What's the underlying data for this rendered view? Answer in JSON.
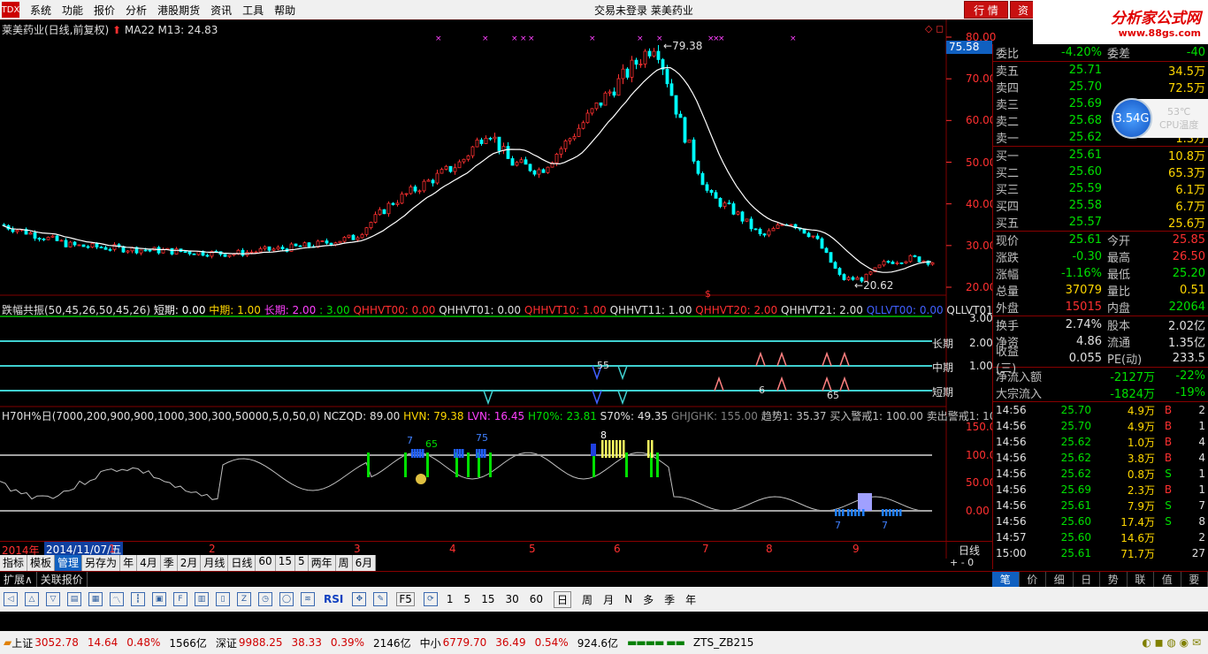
{
  "menu": {
    "logo": "TDX",
    "items": [
      "系统",
      "功能",
      "报价",
      "分析",
      "港股期货",
      "资讯",
      "工具",
      "帮助"
    ],
    "center": "交易未登录   莱美药业",
    "btn_quote": "行 情",
    "btn_info": "资"
  },
  "brand": {
    "title": "分析家公式网",
    "url": "www.88gs.com"
  },
  "main_chart": {
    "title": "莱美药业(日线,前复权)",
    "ma": "MA22  M13: 24.83",
    "price_labels": [
      "80.00",
      "70.00",
      "60.00",
      "50.00",
      "40.00",
      "30.00",
      "20.00"
    ],
    "current_price_tag": "75.58",
    "high_label": "79.38",
    "low_label": "20.62",
    "dollar_mark": "$"
  },
  "indicator1": {
    "header": "跌幅共振(50,45,26,50,45,26)",
    "items": [
      {
        "t": "短期: 0.00",
        "c": "#ffffff"
      },
      {
        "t": "中期: 1.00",
        "c": "#ffd700"
      },
      {
        "t": "长期: 2.00",
        "c": "#ff40ff"
      },
      {
        "t": ": 3.00",
        "c": "#00e000"
      },
      {
        "t": "QHHVT00: 0.00",
        "c": "#ff3030"
      },
      {
        "t": "QHHVT01: 0.00",
        "c": "#e0e0e0"
      },
      {
        "t": "QHHVT10: 1.00",
        "c": "#ff3030"
      },
      {
        "t": "QHHVT11: 1.00",
        "c": "#e0e0e0"
      },
      {
        "t": "QHHVT20: 2.00",
        "c": "#ff3030"
      },
      {
        "t": "QHHVT21: 2.00",
        "c": "#e0e0e0"
      },
      {
        "t": "QLLVT00: 0.00",
        "c": "#4060ff"
      },
      {
        "t": "QLLVT01: 0.0",
        "c": "#e0e0e0"
      }
    ],
    "axis": [
      "3.00",
      "2.00",
      "1.00"
    ],
    "lines": [
      "长期",
      "中期",
      "短期"
    ],
    "marks": [
      "55",
      "6",
      "65"
    ]
  },
  "indicator2": {
    "header": "H70H%日(7000,200,900,900,1000,300,300,50000,5,0,50,0)",
    "items": [
      {
        "t": "NCZQD: 89.00",
        "c": "#e0e0e0"
      },
      {
        "t": "HVN: 79.38",
        "c": "#ffd700"
      },
      {
        "t": "LVN: 16.45",
        "c": "#ff40ff"
      },
      {
        "t": "H70%: 23.81",
        "c": "#00e000"
      },
      {
        "t": "S70%: 49.35",
        "c": "#e0e0e0"
      },
      {
        "t": "GHJGHK: 155.00",
        "c": "#808080"
      },
      {
        "t": "趋势1: 35.37",
        "c": "#c0c0c0"
      },
      {
        "t": "买入警戒1: 100.00",
        "c": "#c0c0c0"
      },
      {
        "t": "卖出警戒1: 100.00",
        "c": "#c0c0c0"
      }
    ],
    "axis": [
      "150.00",
      "100.00",
      "50.00",
      "0.00"
    ],
    "marks": [
      "7",
      "65",
      "75",
      "8",
      "7",
      "7"
    ]
  },
  "time_axis": {
    "year": "2014年",
    "date": "2014/11/07/五",
    "months": [
      "12",
      "1",
      "2",
      "3",
      "4",
      "5",
      "6",
      "7",
      "8",
      "9"
    ],
    "period": "日线"
  },
  "bottom_tabs": [
    "指标",
    "模板",
    "管理",
    "另存为",
    "年",
    "4月",
    "季",
    "2月",
    "月线",
    "日线",
    "60",
    "15",
    "5",
    "两年",
    "周",
    "6月"
  ],
  "sub_tabs": [
    "扩展∧",
    "关联报价"
  ],
  "quote": {
    "weibi": {
      "label": "委比",
      "pct": "-4.20%",
      "label2": "委差",
      "val": "-40"
    },
    "sell": [
      {
        "l": "卖五",
        "p": "25.71",
        "v": "34.5万"
      },
      {
        "l": "卖四",
        "p": "25.70",
        "v": "72.5万"
      },
      {
        "l": "卖三",
        "p": "25.69",
        "v": ""
      },
      {
        "l": "卖二",
        "p": "25.68",
        "v": ""
      },
      {
        "l": "卖一",
        "p": "25.62",
        "v": "1.3万"
      }
    ],
    "buy": [
      {
        "l": "买一",
        "p": "25.61",
        "v": "10.8万"
      },
      {
        "l": "买二",
        "p": "25.60",
        "v": "65.3万"
      },
      {
        "l": "买三",
        "p": "25.59",
        "v": "6.1万"
      },
      {
        "l": "买四",
        "p": "25.58",
        "v": "6.7万"
      },
      {
        "l": "买五",
        "p": "25.57",
        "v": "25.6万"
      }
    ],
    "stats": [
      {
        "l": "现价",
        "v": "25.61",
        "l2": "今开",
        "v2": "25.85",
        "c": "#00e000",
        "c2": "#ff3030"
      },
      {
        "l": "涨跌",
        "v": "-0.30",
        "l2": "最高",
        "v2": "26.50",
        "c": "#00e000",
        "c2": "#ff3030"
      },
      {
        "l": "涨幅",
        "v": "-1.16%",
        "l2": "最低",
        "v2": "25.20",
        "c": "#00e000",
        "c2": "#00e000"
      },
      {
        "l": "总量",
        "v": "37079",
        "l2": "量比",
        "v2": "0.51",
        "c": "#ffd700",
        "c2": "#ffd700"
      },
      {
        "l": "外盘",
        "v": "15015",
        "l2": "内盘",
        "v2": "22064",
        "c": "#ff3030",
        "c2": "#00e000"
      }
    ],
    "stats2": [
      {
        "l": "换手",
        "v": "2.74%",
        "l2": "股本",
        "v2": "2.02亿"
      },
      {
        "l": "净资",
        "v": "4.86",
        "l2": "流通",
        "v2": "1.35亿"
      },
      {
        "l": "收益(三)",
        "v": "0.055",
        "l2": "PE(动)",
        "v2": "233.5"
      }
    ],
    "flow": [
      {
        "l": "净流入额",
        "v": "-2127万",
        "p": "-22%"
      },
      {
        "l": "大宗流入",
        "v": "-1824万",
        "p": "-19%"
      }
    ],
    "ticks": [
      {
        "t": "14:56",
        "p": "25.70",
        "v": "4.9万",
        "s": "B",
        "n": "2"
      },
      {
        "t": "14:56",
        "p": "25.70",
        "v": "4.9万",
        "s": "B",
        "n": "1"
      },
      {
        "t": "14:56",
        "p": "25.62",
        "v": "1.0万",
        "s": "B",
        "n": "4"
      },
      {
        "t": "14:56",
        "p": "25.62",
        "v": "3.8万",
        "s": "B",
        "n": "4"
      },
      {
        "t": "14:56",
        "p": "25.62",
        "v": "0.8万",
        "s": "S",
        "n": "1"
      },
      {
        "t": "14:56",
        "p": "25.69",
        "v": "2.3万",
        "s": "B",
        "n": "1"
      },
      {
        "t": "14:56",
        "p": "25.61",
        "v": "7.9万",
        "s": "S",
        "n": "7"
      },
      {
        "t": "14:56",
        "p": "25.60",
        "v": "17.4万",
        "s": "S",
        "n": "8"
      },
      {
        "t": "14:57",
        "p": "25.60",
        "v": "14.6万",
        "s": "",
        "n": "2"
      },
      {
        "t": "15:00",
        "p": "25.61",
        "v": "71.7万",
        "s": "",
        "n": "27"
      }
    ]
  },
  "cpu": {
    "value": "3.54G",
    "temp": "53℃",
    "label": "CPU温度"
  },
  "right_tabs": [
    "笔",
    "价",
    "细",
    "日",
    "势",
    "联",
    "值",
    "要"
  ],
  "toolbar": {
    "nums": [
      "1",
      "5",
      "15",
      "30",
      "60",
      "日",
      "周",
      "月",
      "N",
      "多",
      "季",
      "年"
    ],
    "rsi": "RSI",
    "f5": "F5"
  },
  "status": {
    "sh": {
      "n": "上证",
      "v": "3052.78",
      "c": "14.64",
      "p": "0.48%",
      "a": "1566亿"
    },
    "sz": {
      "n": "深证",
      "v": "9988.25",
      "c": "38.33",
      "p": "0.39%",
      "a": "2146亿"
    },
    "zx": {
      "n": "中小",
      "v": "6779.70",
      "c": "36.49",
      "p": "0.54%",
      "a": "924.6亿"
    },
    "server": "ZTS_ZB215"
  },
  "colors": {
    "up": "#ff3030",
    "down": "#00ffff",
    "ma": "#ffffff",
    "grid": "#800000"
  }
}
